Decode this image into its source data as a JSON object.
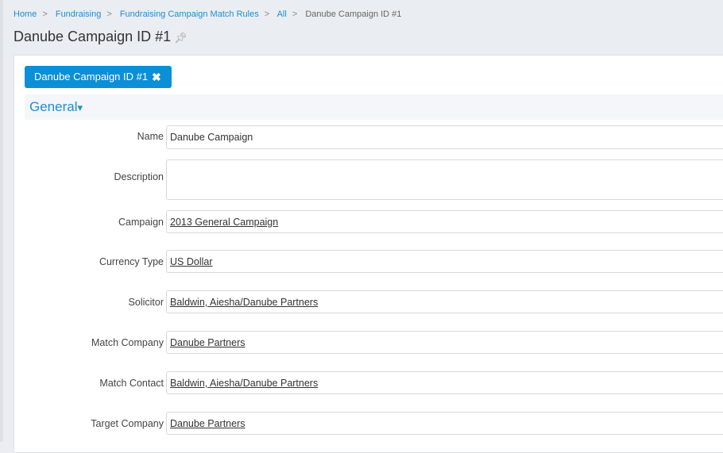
{
  "breadcrumb": {
    "items": [
      "Home",
      "Fundraising",
      "Fundraising Campaign Match Rules",
      "All"
    ],
    "current": "Danube Campaign ID #1"
  },
  "page_title": "Danube Campaign ID #1",
  "tab": {
    "label": "Danube Campaign ID #1",
    "close": "✖"
  },
  "section": {
    "label": "General",
    "arrow": "▾"
  },
  "fields": [
    {
      "label": "Name",
      "value": "Danube Campaign"
    },
    {
      "label": "Description",
      "value": ""
    },
    {
      "label": "Campaign",
      "value": "2013 General Campaign"
    },
    {
      "label": "Currency Type",
      "value": "US Dollar"
    },
    {
      "label": "Solicitor",
      "value": "Baldwin, Aiesha/Danube Partners"
    },
    {
      "label": "Match Company",
      "value": "Danube Partners"
    },
    {
      "label": "Match Contact",
      "value": "Baldwin, Aiesha/Danube Partners"
    },
    {
      "label": "Target Company",
      "value": "Danube Partners"
    }
  ]
}
